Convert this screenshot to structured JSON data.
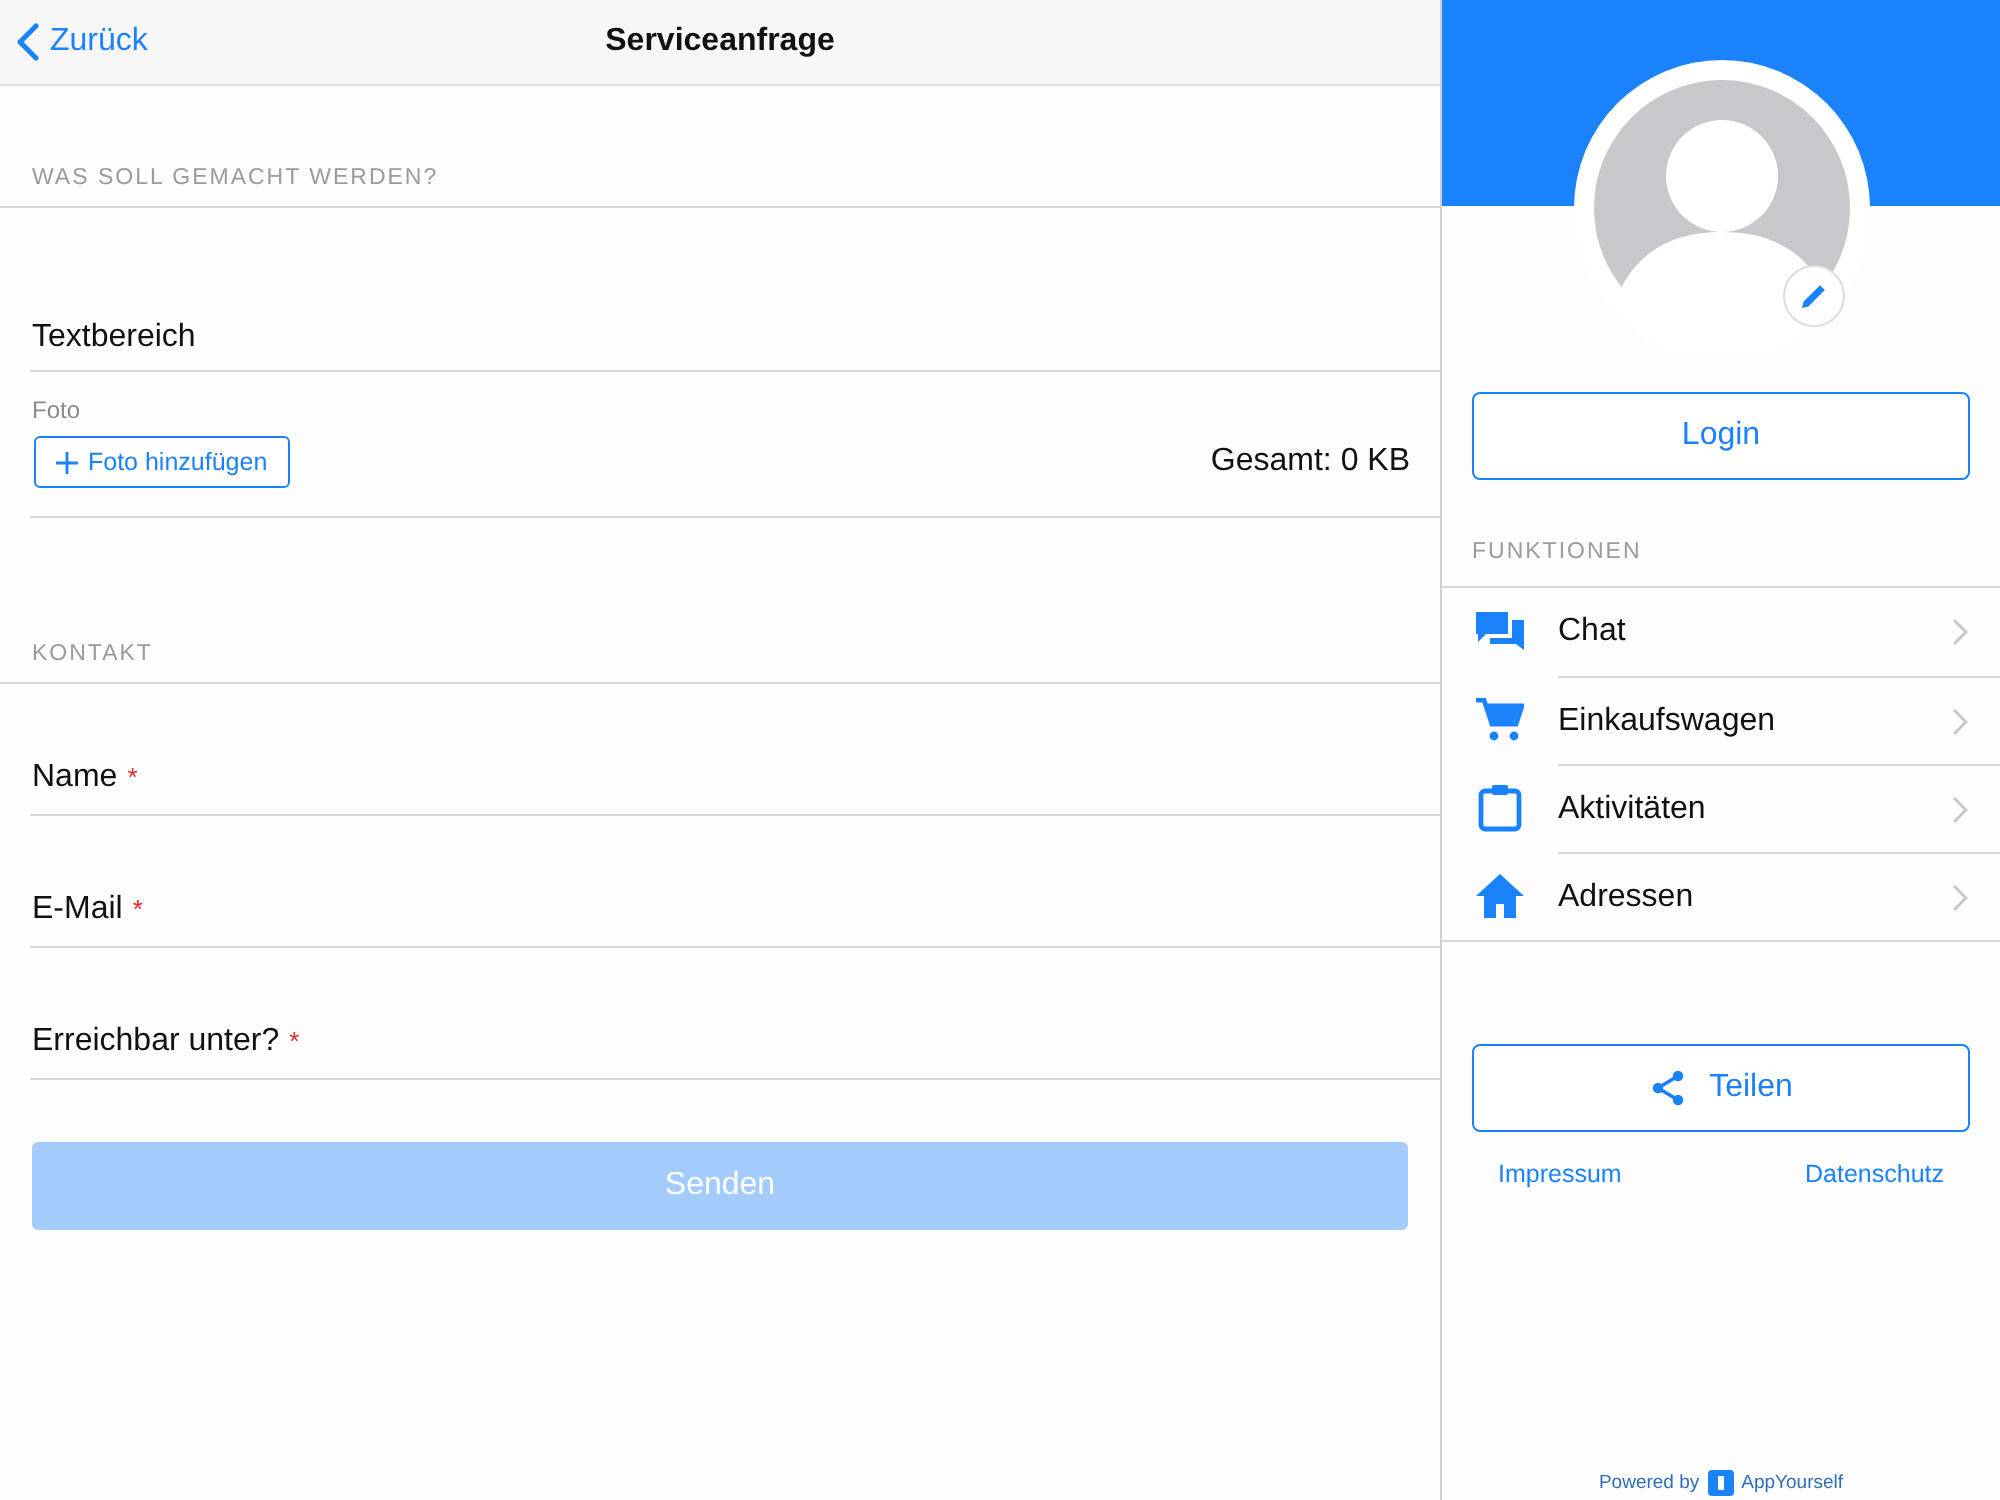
{
  "header": {
    "back": "Zurück",
    "title": "Serviceanfrage"
  },
  "request_section": {
    "heading": "WAS SOLL GEMACHT WERDEN?",
    "textarea": {
      "placeholder": "Textbereich"
    },
    "photo_label": "Foto",
    "add_photo": "Foto hinzufügen",
    "total": "Gesamt: 0 KB"
  },
  "contact_section": {
    "heading": "KONTAKT",
    "fields": [
      {
        "placeholder": "Name",
        "required_mark": "*"
      },
      {
        "placeholder": "E-Mail",
        "required_mark": "*"
      },
      {
        "placeholder": "Erreichbar unter?",
        "required_mark": "*"
      }
    ]
  },
  "submit": {
    "label": "Senden",
    "disabled": true
  },
  "sidebar": {
    "login": "Login",
    "functions_heading": "FUNKTIONEN",
    "items": [
      {
        "kind": "chat",
        "label": "Chat"
      },
      {
        "kind": "cart",
        "label": "Einkaufswagen"
      },
      {
        "kind": "clipboard",
        "label": "Aktivitäten"
      },
      {
        "kind": "home",
        "label": "Adressen"
      }
    ],
    "share": "Teilen",
    "links": [
      "Impressum",
      "Datenschutz"
    ],
    "powered_by": "Powered by",
    "brand": "AppYourself"
  }
}
